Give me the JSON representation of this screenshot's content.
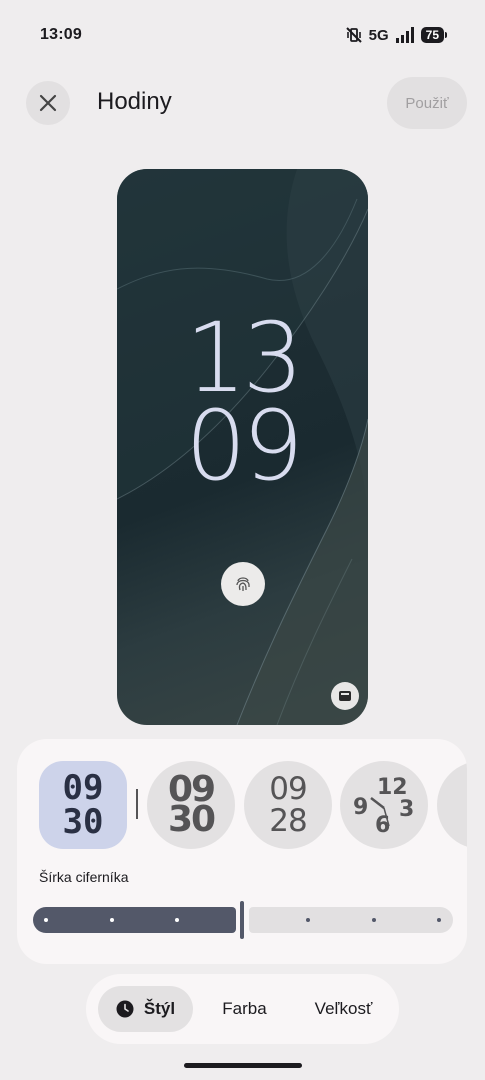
{
  "status_bar": {
    "time": "13:09",
    "network": "5G",
    "battery": "75"
  },
  "header": {
    "title": "Hodiny",
    "apply_label": "Použiť"
  },
  "preview": {
    "clock_hours": "13",
    "clock_minutes": "09"
  },
  "styles": {
    "options": [
      {
        "line1": "09",
        "line2": "30",
        "selected": true
      },
      {
        "line1": "09",
        "line2": "30",
        "selected": false
      },
      {
        "line1": "09",
        "line2": "28",
        "selected": false
      },
      {
        "line1": "12",
        "line2": "9 3 6",
        "selected": false
      }
    ]
  },
  "width_slider": {
    "label": "Šírka ciferníka",
    "value": 0.5,
    "steps": 7
  },
  "tabs": [
    {
      "label": "Štýl",
      "active": true
    },
    {
      "label": "Farba",
      "active": false
    },
    {
      "label": "Veľkosť",
      "active": false
    }
  ],
  "colors": {
    "accent": "#535869",
    "selected_container": "#cdd3ea",
    "background": "#efedee"
  }
}
